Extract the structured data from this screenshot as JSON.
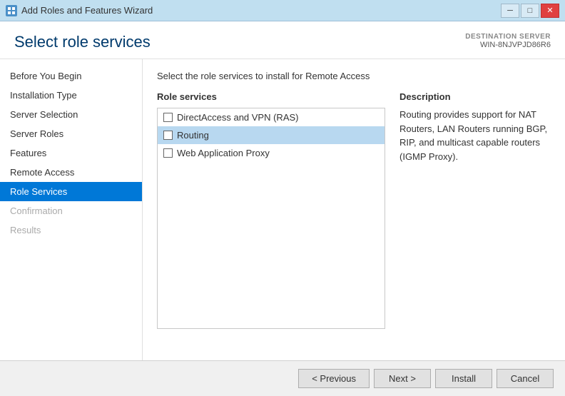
{
  "titlebar": {
    "title": "Add Roles and Features Wizard",
    "icon_label": "W",
    "minimize_label": "─",
    "maximize_label": "□",
    "close_label": "✕"
  },
  "header": {
    "page_title": "Select role services",
    "destination_server_label": "DESTINATION SERVER",
    "destination_server_name": "WIN-8NJVPJD86R6"
  },
  "instruction": "Select the role services to install for Remote Access",
  "sidebar": {
    "items": [
      {
        "id": "before-you-begin",
        "label": "Before You Begin",
        "state": "normal"
      },
      {
        "id": "installation-type",
        "label": "Installation Type",
        "state": "normal"
      },
      {
        "id": "server-selection",
        "label": "Server Selection",
        "state": "normal"
      },
      {
        "id": "server-roles",
        "label": "Server Roles",
        "state": "normal"
      },
      {
        "id": "features",
        "label": "Features",
        "state": "normal"
      },
      {
        "id": "remote-access",
        "label": "Remote Access",
        "state": "normal"
      },
      {
        "id": "role-services",
        "label": "Role Services",
        "state": "active"
      },
      {
        "id": "confirmation",
        "label": "Confirmation",
        "state": "disabled"
      },
      {
        "id": "results",
        "label": "Results",
        "state": "disabled"
      }
    ]
  },
  "role_services": {
    "panel_header": "Role services",
    "items": [
      {
        "id": "directaccess-vpn",
        "label": "DirectAccess and VPN (RAS)",
        "checked": false,
        "selected": false
      },
      {
        "id": "routing",
        "label": "Routing",
        "checked": false,
        "selected": true
      },
      {
        "id": "web-app-proxy",
        "label": "Web Application Proxy",
        "checked": false,
        "selected": false
      }
    ]
  },
  "description": {
    "panel_header": "Description",
    "text": "Routing provides support for NAT Routers, LAN Routers running BGP, RIP, and multicast capable routers (IGMP Proxy)."
  },
  "footer": {
    "previous_label": "< Previous",
    "next_label": "Next >",
    "install_label": "Install",
    "cancel_label": "Cancel"
  }
}
